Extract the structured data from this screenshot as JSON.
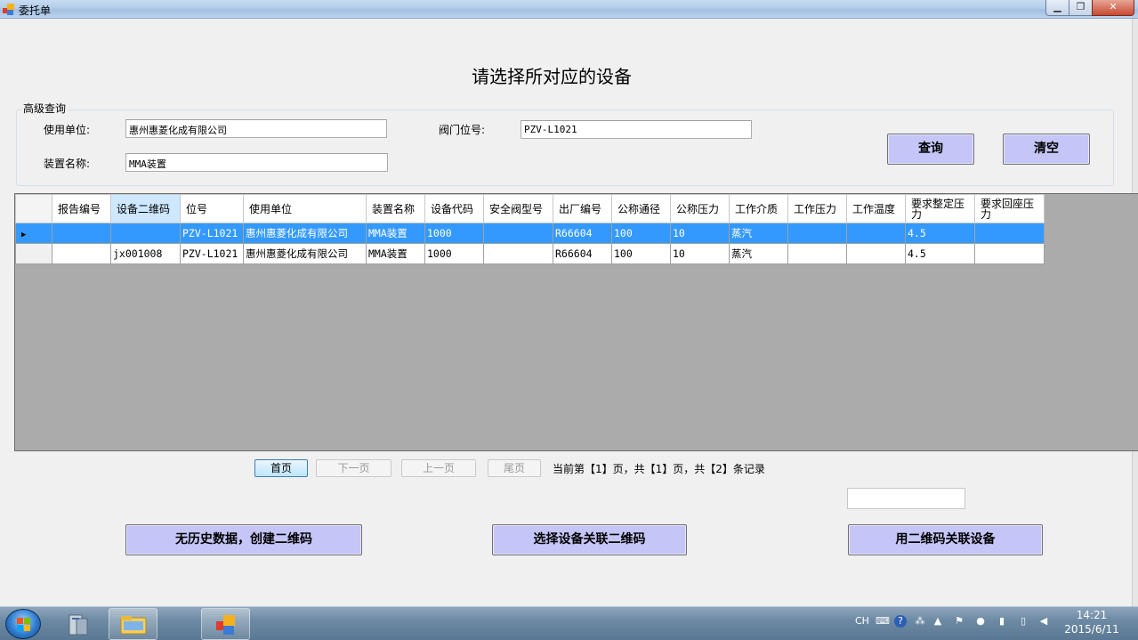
{
  "window": {
    "title": "委托单"
  },
  "heading": "请选择所对应的设备",
  "search": {
    "legend": "高级查询",
    "unit_label": "使用单位:",
    "unit_value": "惠州惠菱化成有限公司",
    "valve_label": "阀门位号:",
    "valve_value": "PZV-L1021",
    "device_label": "装置名称:",
    "device_value": "MMA装置",
    "query_button": "查询",
    "clear_button": "清空"
  },
  "grid": {
    "columns": [
      "报告编号",
      "设备二维码",
      "位号",
      "使用单位",
      "装置名称",
      "设备代码",
      "安全阀型号",
      "出厂编号",
      "公称通径",
      "公称压力",
      "工作介质",
      "工作压力",
      "工作温度",
      "要求整定压力",
      "要求回座压力"
    ],
    "rows": [
      [
        "",
        "",
        "PZV-L1021",
        "惠州惠菱化成有限公司",
        "MMA装置",
        "1000",
        "",
        "R66604",
        "100",
        "10",
        "蒸汽",
        "",
        "",
        "4.5",
        ""
      ],
      [
        "",
        "jx001008",
        "PZV-L1021",
        "惠州惠菱化成有限公司",
        "MMA装置",
        "1000",
        "",
        "R66604",
        "100",
        "10",
        "蒸汽",
        "",
        "",
        "4.5",
        ""
      ]
    ],
    "selected_row": 0,
    "current_row_marker": "▶"
  },
  "pager": {
    "first": "首页",
    "next": "下一页",
    "prev": "上一页",
    "last": "尾页",
    "info": "当前第【1】页，共【1】页，共【2】条记录"
  },
  "actions": {
    "create_qr": "无历史数据，创建二维码",
    "select_device": "选择设备关联二维码",
    "link_device": "用二维码关联设备"
  },
  "taskbar": {
    "lang": "CH",
    "time": "14:21",
    "date": "2015/6/11"
  },
  "colors": {
    "button_purple": "#c5c6f7",
    "selected_row": "#3399ff",
    "grid_background": "#ababab"
  }
}
